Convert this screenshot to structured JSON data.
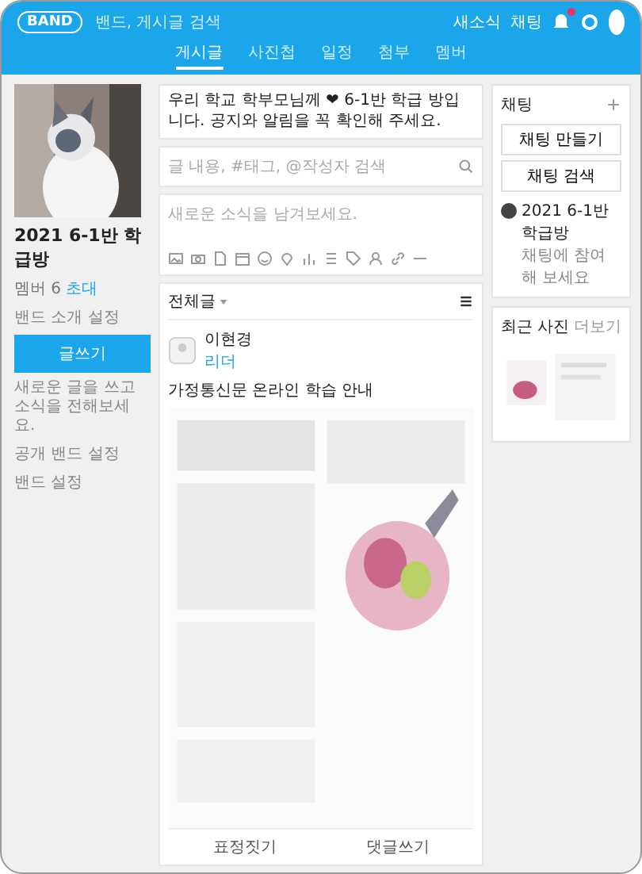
{
  "top_bar": {
    "logo": "BAND",
    "search": {
      "placeholder": "밴드, 게시글 검색"
    },
    "links": [
      "새소식",
      "채팅"
    ],
    "has_notification": true
  },
  "tabs": [
    {
      "label": "게시글",
      "selected": true
    },
    {
      "label": "사진첩",
      "selected": false
    },
    {
      "label": "일정",
      "selected": false
    },
    {
      "label": "첨부",
      "selected": false
    },
    {
      "label": "멤버",
      "selected": false
    }
  ],
  "band": {
    "kind": "picture",
    "name": "2021 6-1반 학급방",
    "members_label": "멤버 6",
    "invite": "초대",
    "intro": "밴드 소개 설정",
    "write_button": "글쓰기",
    "description": "새로운 글을 쓰고 소식을 전해보세요.",
    "links": [
      "공개 밴드 설정",
      "밴드 설정"
    ]
  },
  "notice": {
    "text": "우리 학교 학부모님께 ❤ 6-1반 학급 방입니다. 공지와 알림을 꼭 확인해 주세요."
  },
  "search": {
    "placeholder": "글 내용, #태그, @작성자 검색"
  },
  "compose": {
    "placeholder": "새로운 소식을 남겨보세요."
  },
  "feed": {
    "filter": "전체글"
  },
  "post": {
    "author": "이현경",
    "role": "리더",
    "title": "가정통신문 온라인 학습 안내",
    "actions": [
      "표정짓기",
      "댓글쓰기"
    ]
  },
  "chat": {
    "title": "채팅",
    "buttons": [
      "채팅 만들기",
      "채팅 검색"
    ],
    "room": {
      "name": "2021 6-1반 학급방",
      "preview": "채팅에 참여해 보세요"
    }
  },
  "photos": {
    "title": "최근 사진",
    "more": "더보기"
  }
}
